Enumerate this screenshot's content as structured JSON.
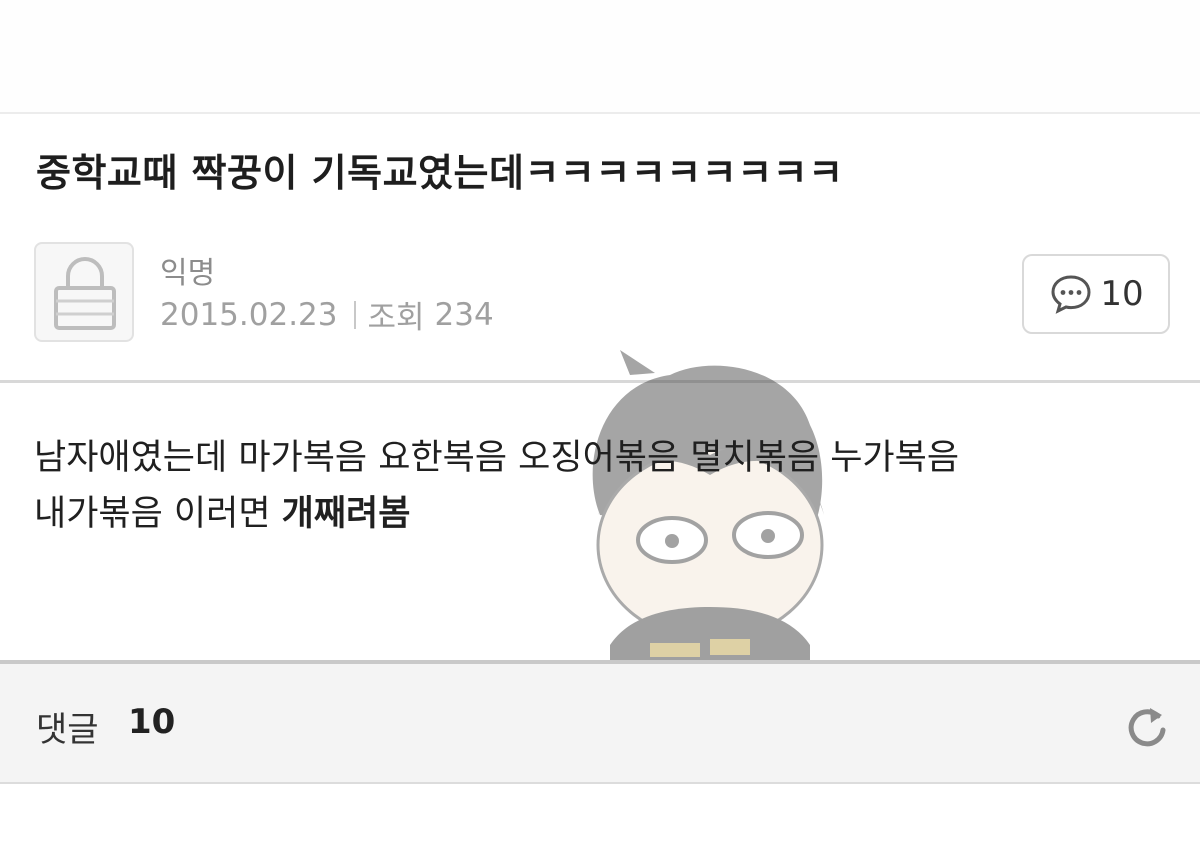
{
  "post": {
    "title": "중학교때 짝꿍이 기독교였는데ㅋㅋㅋㅋㅋㅋㅋㅋㅋ",
    "author": "익명",
    "date": "2015.02.23",
    "views_label": "조회",
    "views": "234",
    "comment_count": "10",
    "body_line1": "남자애였는데 마가복음 요한복음 오징어볶음 멸치볶음 누가복음",
    "body_line2_prefix": "내가볶음 이러면 ",
    "body_line2_emph": "개째려봄"
  },
  "comments": {
    "label": "댓글",
    "count": "10"
  },
  "icons": {
    "avatar": "lock-icon",
    "comment": "speech-bubble-icon",
    "refresh": "refresh-icon",
    "overlay": "cartoon-character-illustration"
  },
  "colors": {
    "background": "#ffffff",
    "comments_bar": "#f4f4f4",
    "meta_text": "#a0a0a0"
  }
}
